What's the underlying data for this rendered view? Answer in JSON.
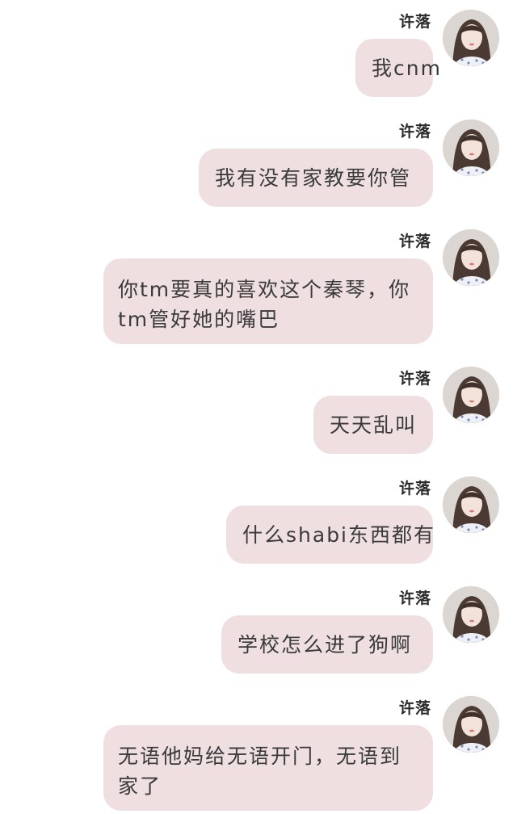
{
  "messages": [
    {
      "sender": "许落",
      "text": "我cnm"
    },
    {
      "sender": "许落",
      "text": "我有没有家教要你管"
    },
    {
      "sender": "许落",
      "text": "你tm要真的喜欢这个秦琴，你tm管好她的嘴巴"
    },
    {
      "sender": "许落",
      "text": "天天乱叫"
    },
    {
      "sender": "许落",
      "text": "什么shabi东西都有"
    },
    {
      "sender": "许落",
      "text": "学校怎么进了狗啊"
    },
    {
      "sender": "许落",
      "text": "无语他妈给无语开门，无语到家了"
    }
  ],
  "colors": {
    "bubble": "#efdfe1",
    "text": "#3a3a3a",
    "background": "#ffffff"
  }
}
